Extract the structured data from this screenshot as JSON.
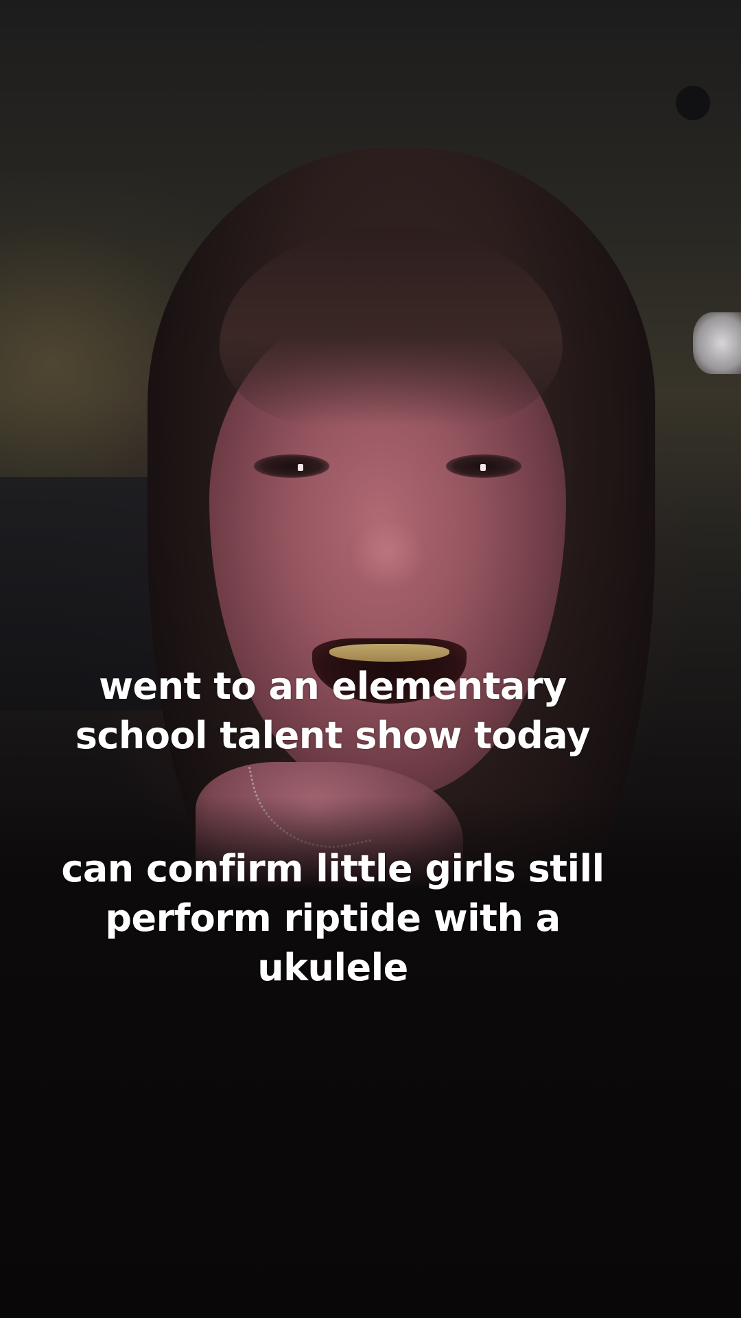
{
  "captions": {
    "first": {
      "lines": [
        "went to an elementary",
        "school talent show today"
      ]
    },
    "second": {
      "lines": [
        "can confirm little girls still",
        "perform riptide with a",
        "ukulele"
      ]
    }
  },
  "colors": {
    "caption_text": "#ffffff",
    "background": "#0a0808"
  }
}
